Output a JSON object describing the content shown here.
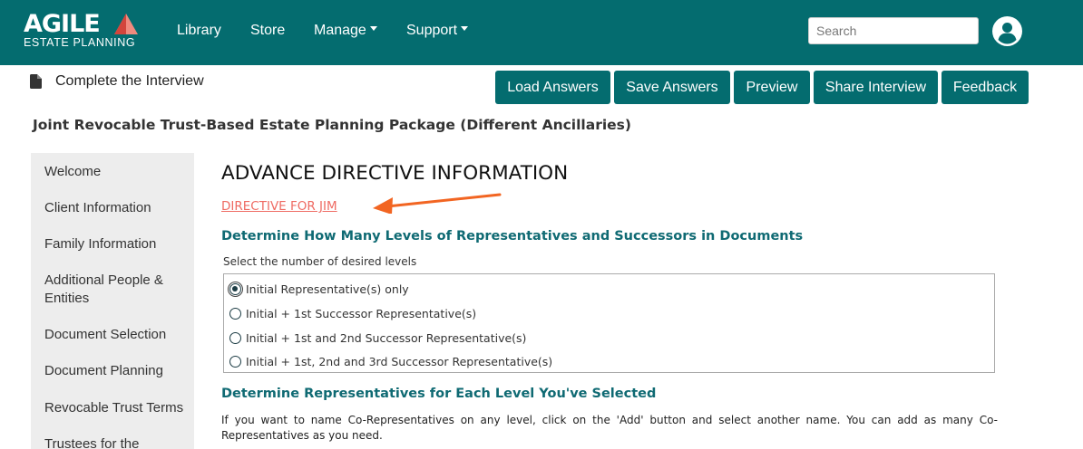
{
  "logo": {
    "word": "AGILE",
    "subtitle": "ESTATE PLANNING"
  },
  "nav": {
    "library": "Library",
    "store": "Store",
    "manage": "Manage",
    "support": "Support"
  },
  "search": {
    "placeholder": "Search",
    "value": ""
  },
  "subheader": {
    "complete_label": "Complete the Interview"
  },
  "toolbar": {
    "load": "Load Answers",
    "save": "Save Answers",
    "preview": "Preview",
    "share": "Share Interview",
    "feedback": "Feedback"
  },
  "package_title": "Joint Revocable Trust-Based Estate Planning Package (Different Ancillaries)",
  "sidebar": {
    "items": [
      {
        "label": "Welcome"
      },
      {
        "label": "Client Information"
      },
      {
        "label": "Family Information"
      },
      {
        "label": "Additional People & Entities"
      },
      {
        "label": "Document Selection"
      },
      {
        "label": "Document Planning"
      },
      {
        "label": "Revocable Trust Terms"
      },
      {
        "label": "Trustees for the"
      }
    ]
  },
  "main": {
    "title": "ADVANCE DIRECTIVE INFORMATION",
    "directive_link": "DIRECTIVE FOR JIM",
    "section1_heading": "Determine How Many Levels of Representatives and Successors in Documents",
    "question_label": "Select the number of desired levels",
    "options": [
      {
        "label": "Initial Representative(s) only",
        "selected": true
      },
      {
        "label": "Initial + 1st Successor Representative(s)",
        "selected": false
      },
      {
        "label": "Initial + 1st and 2nd Successor Representative(s)",
        "selected": false
      },
      {
        "label": "Initial + 1st, 2nd and 3rd Successor Representative(s)",
        "selected": false
      }
    ],
    "section2_heading": "Determine Representatives for Each Level You've Selected",
    "paragraph": "If you want to name Co-Representatives on any level, click on the 'Add' button and select another name. You can add as many Co-Representatives as you need."
  },
  "colors": {
    "brand_teal": "#046c6f",
    "heading_teal": "#0f6a73",
    "link_coral": "#ef6b63",
    "arrow_orange": "#f26522",
    "logo_triangle_dark": "#d2453c",
    "logo_triangle_light": "#f08a7e"
  },
  "icons": [
    "document-icon",
    "user-icon",
    "chevron-down-icon",
    "arrow-icon"
  ]
}
